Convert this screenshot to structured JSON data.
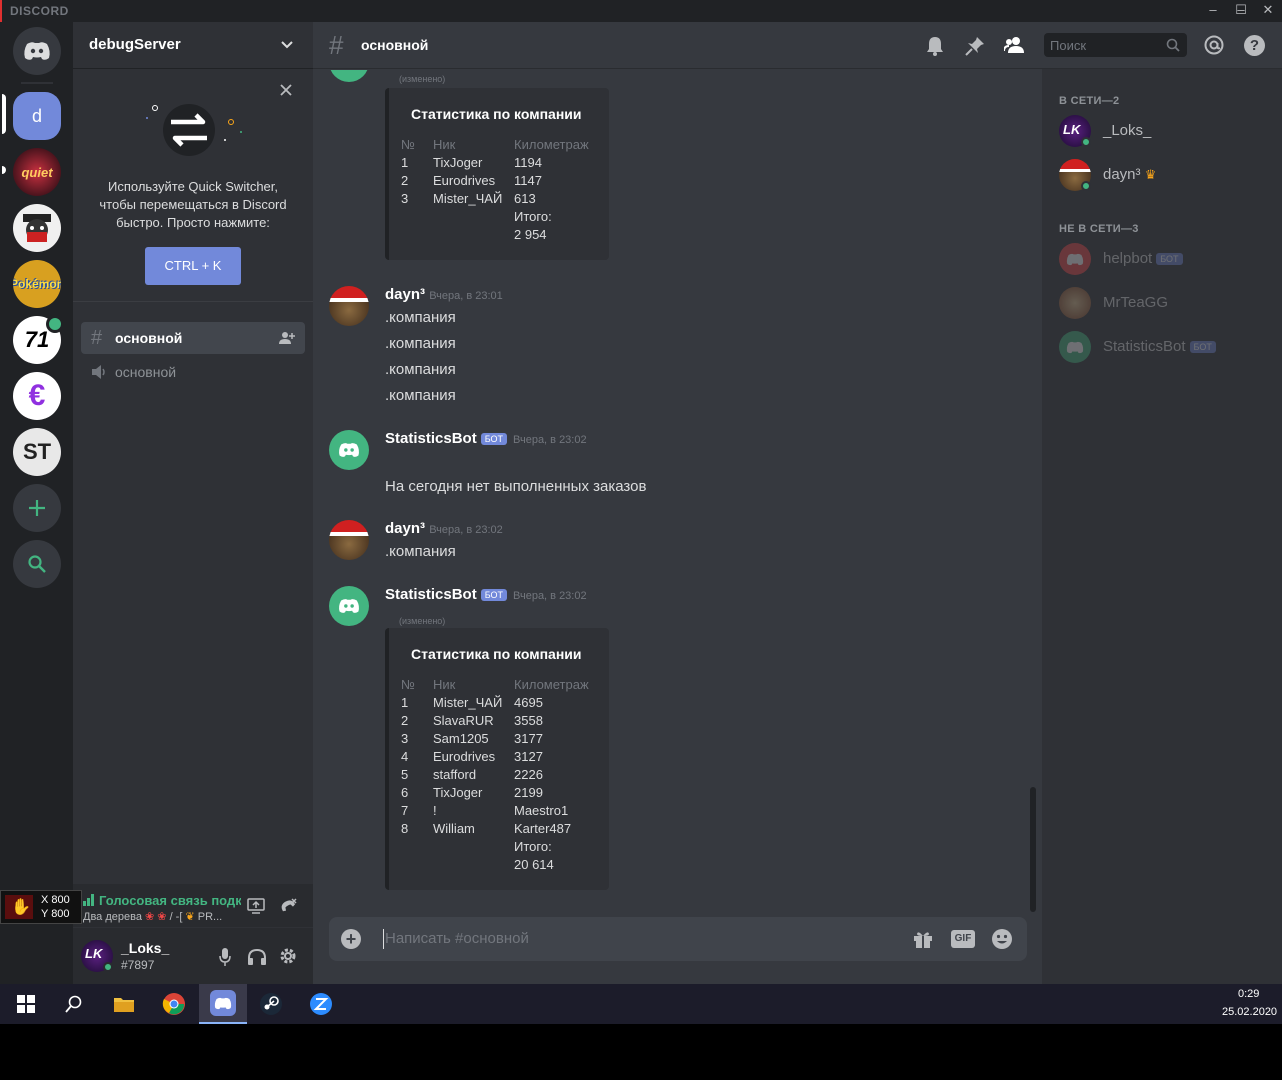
{
  "app": {
    "brand": "DISCORD",
    "window_controls": [
      "–",
      "☐",
      "✕"
    ]
  },
  "guilds": [
    {
      "name": "home",
      "label": "",
      "bg": "#36393f"
    },
    {
      "name": "debugServer",
      "label": "d",
      "bg": "#7289da"
    },
    {
      "name": "server-quiet",
      "label": "",
      "bg": "#7a1e2e"
    },
    {
      "name": "server-bandit",
      "label": "",
      "bg": "#f0f0f0"
    },
    {
      "name": "server-pokemon",
      "label": "",
      "bg": "#d8a020"
    },
    {
      "name": "server-company",
      "label": "",
      "bg": "#ffffff"
    },
    {
      "name": "server-euro",
      "label": "€",
      "bg": "#ffffff"
    },
    {
      "name": "server-st",
      "label": "ST",
      "bg": "#e8e8e8"
    }
  ],
  "sidebar": {
    "server_name": "debugServer",
    "quick_switcher": {
      "text": "Используйте Quick Switcher, чтобы перемещаться в Discord быстро. Просто нажмите:",
      "button": "CTRL + K"
    },
    "channels": [
      {
        "name": "основной",
        "type": "text",
        "active": true
      },
      {
        "name": "основной",
        "type": "voice",
        "active": false
      }
    ],
    "voice": {
      "status": "Голосовая связь подкл",
      "detail": "Два дерева"
    },
    "overlay": {
      "x": "X 800",
      "y": "Y 800"
    },
    "user": {
      "name": "_Loks_",
      "tag": "#7897"
    }
  },
  "header": {
    "channel": "основной",
    "search_placeholder": "Поиск"
  },
  "messages": {
    "edited": "(изменено)",
    "bot_badge": "БОТ",
    "embed1": {
      "title": "Статистика по компании",
      "headers": [
        "№",
        "Ник",
        "Километраж"
      ],
      "rows": [
        [
          "1",
          "TixJoger",
          "1194"
        ],
        [
          "2",
          "Eurodrives",
          "1147"
        ],
        [
          "3",
          "Mister_ЧАЙ",
          "613"
        ]
      ],
      "total_label": "Итого:",
      "total": "2 954"
    },
    "m1": {
      "author": "dayn³",
      "time": "Вчера, в 23:01",
      "lines": [
        ".компания",
        ".компания",
        ".компания",
        ".компания"
      ]
    },
    "m2": {
      "author": "StatisticsBot",
      "time": "Вчера, в 23:02",
      "text": "На сегодня нет выполненных заказов"
    },
    "m3": {
      "author": "dayn³",
      "time": "Вчера, в 23:02",
      "text": ".компания"
    },
    "m4": {
      "author": "StatisticsBot",
      "time": "Вчера, в 23:02"
    },
    "embed2": {
      "title": "Статистика по компании",
      "headers": [
        "№",
        "Ник",
        "Километраж"
      ],
      "rows": [
        [
          "1",
          "Mister_ЧАЙ",
          "4695"
        ],
        [
          "2",
          "SlavaRUR",
          "3558"
        ],
        [
          "3",
          "Sam1205",
          "3177"
        ],
        [
          "4",
          "Eurodrives",
          "3127"
        ],
        [
          "5",
          "stafford",
          "2226"
        ],
        [
          "6",
          "TixJoger",
          "2199"
        ],
        [
          "7",
          "!",
          "Maestro1"
        ],
        [
          "8",
          "William",
          "Karter487"
        ]
      ],
      "total_label": "Итого:",
      "total": "20 614"
    }
  },
  "composer": {
    "placeholder": "Написать #основной",
    "gif": "GIF"
  },
  "members": {
    "online_header": "В СЕТИ—2",
    "offline_header": "НЕ В СЕТИ—3",
    "online": [
      {
        "name": "_Loks_"
      },
      {
        "name": "dayn³"
      }
    ],
    "offline": [
      {
        "name": "helpbot",
        "bot": true
      },
      {
        "name": "MrTeaGG",
        "bot": false
      },
      {
        "name": "StatisticsBot",
        "bot": true
      }
    ]
  },
  "taskbar": {
    "time": "0:29",
    "date": "25.02.2020"
  }
}
